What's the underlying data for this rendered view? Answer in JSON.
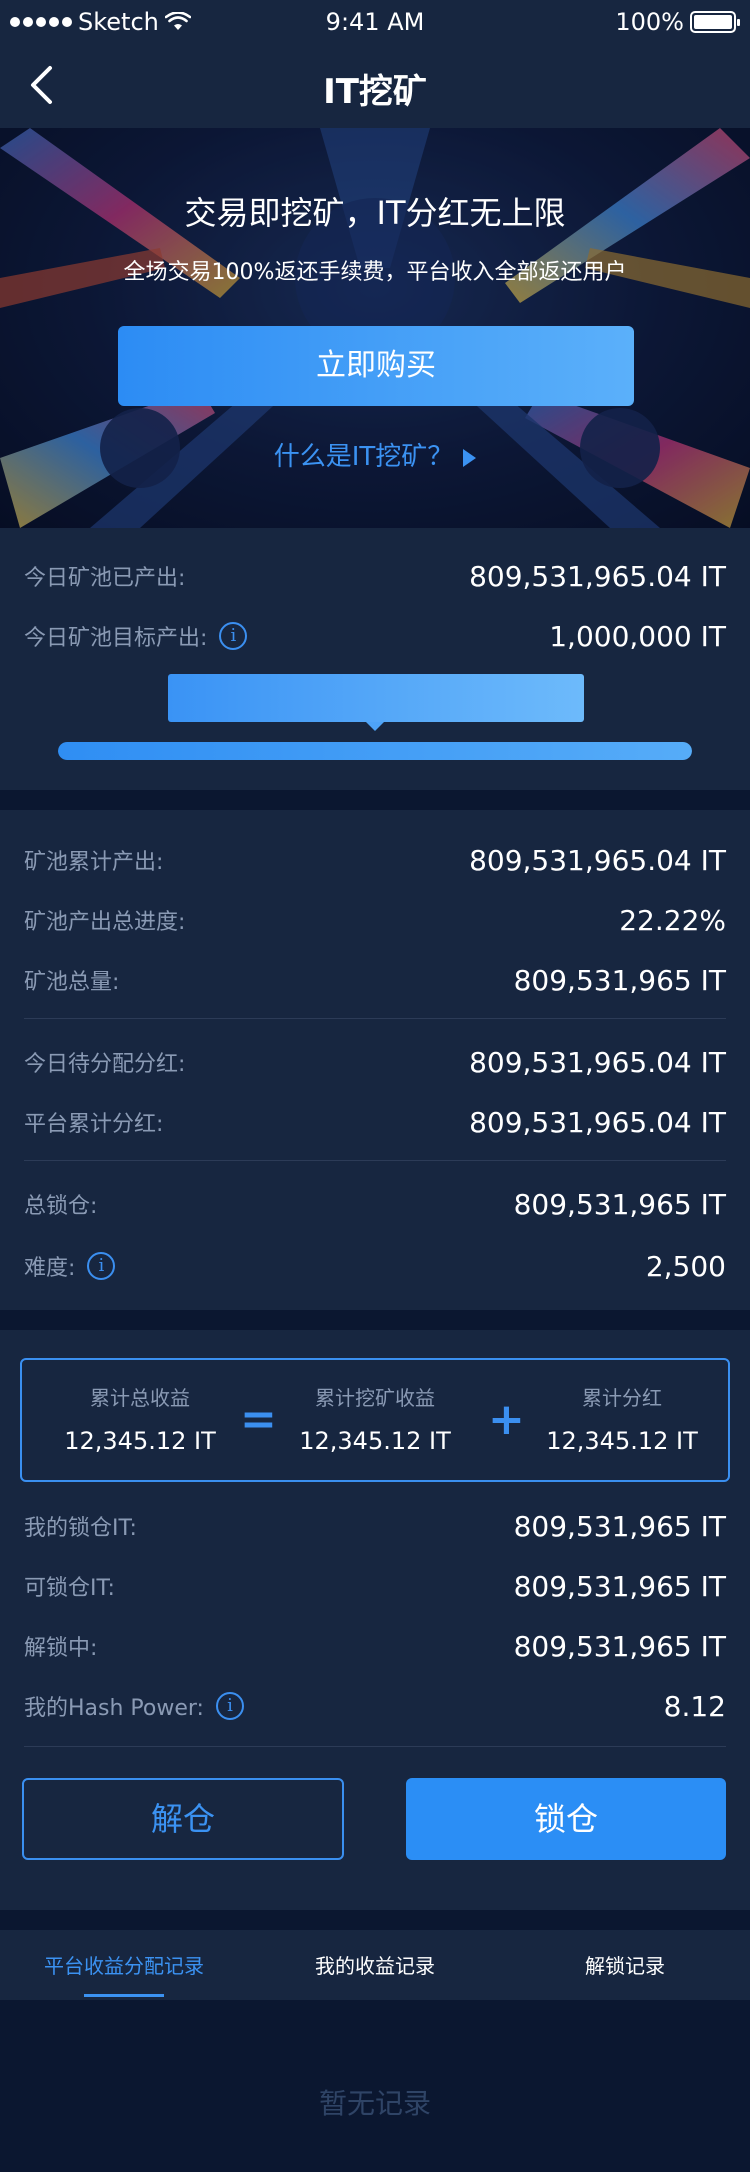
{
  "status_bar": {
    "carrier": "Sketch",
    "time": "9:41 AM",
    "battery": "100%"
  },
  "nav": {
    "title": "IT挖矿",
    "back_icon": "chevron-left-icon"
  },
  "hero": {
    "headline": "交易即挖矿，IT分红无上限",
    "subtitle": "全场交易100%返还手续费，平台收入全部返还用户",
    "buy_label": "立即购买",
    "what_label": "什么是IT挖矿？"
  },
  "today": {
    "produced_label": "今日矿池已产出:",
    "produced_value": "809,531,965.04 IT",
    "target_label": "今日矿池目标产出:",
    "target_value": "1,000,000 IT",
    "progress_fraction": 1.0
  },
  "pool": {
    "rows": [
      {
        "label": "矿池累计产出:",
        "value": "809,531,965.04 IT"
      },
      {
        "label": "矿池产出总进度:",
        "value": "22.22%"
      },
      {
        "label": "矿池总量:",
        "value": "809,531,965 IT"
      },
      {
        "label": "今日待分配分红:",
        "value": "809,531,965.04 IT"
      },
      {
        "label": "平台累计分红:",
        "value": "809,531,965.04 IT"
      },
      {
        "label": "总锁仓:",
        "value": "809,531,965 IT"
      },
      {
        "label": "难度:",
        "value": "2,500"
      }
    ]
  },
  "summary": {
    "total_label": "累计总收益",
    "total_value": "12,345.12 IT",
    "mining_label": "累计挖矿收益",
    "mining_value": "12,345.12 IT",
    "dividend_label": "累计分红",
    "dividend_value": "12,345.12 IT",
    "equals": "=",
    "plus": "+"
  },
  "mine": {
    "rows": [
      {
        "label": "我的锁仓IT:",
        "value": "809,531,965 IT"
      },
      {
        "label": "可锁仓IT:",
        "value": "809,531,965 IT"
      },
      {
        "label": "解锁中:",
        "value": "809,531,965 IT"
      },
      {
        "label": "我的Hash Power:",
        "value": "8.12"
      }
    ],
    "unlock_label": "解仓",
    "lock_label": "锁仓"
  },
  "tabs": [
    {
      "label": "平台收益分配记录",
      "active": true
    },
    {
      "label": "我的收益记录",
      "active": false
    },
    {
      "label": "解锁记录",
      "active": false
    }
  ],
  "empty_text": "暂无记录",
  "colors": {
    "accent": "#2b8ef5",
    "panel": "#172640",
    "page": "#0b1730",
    "label": "#8a9ab4"
  }
}
